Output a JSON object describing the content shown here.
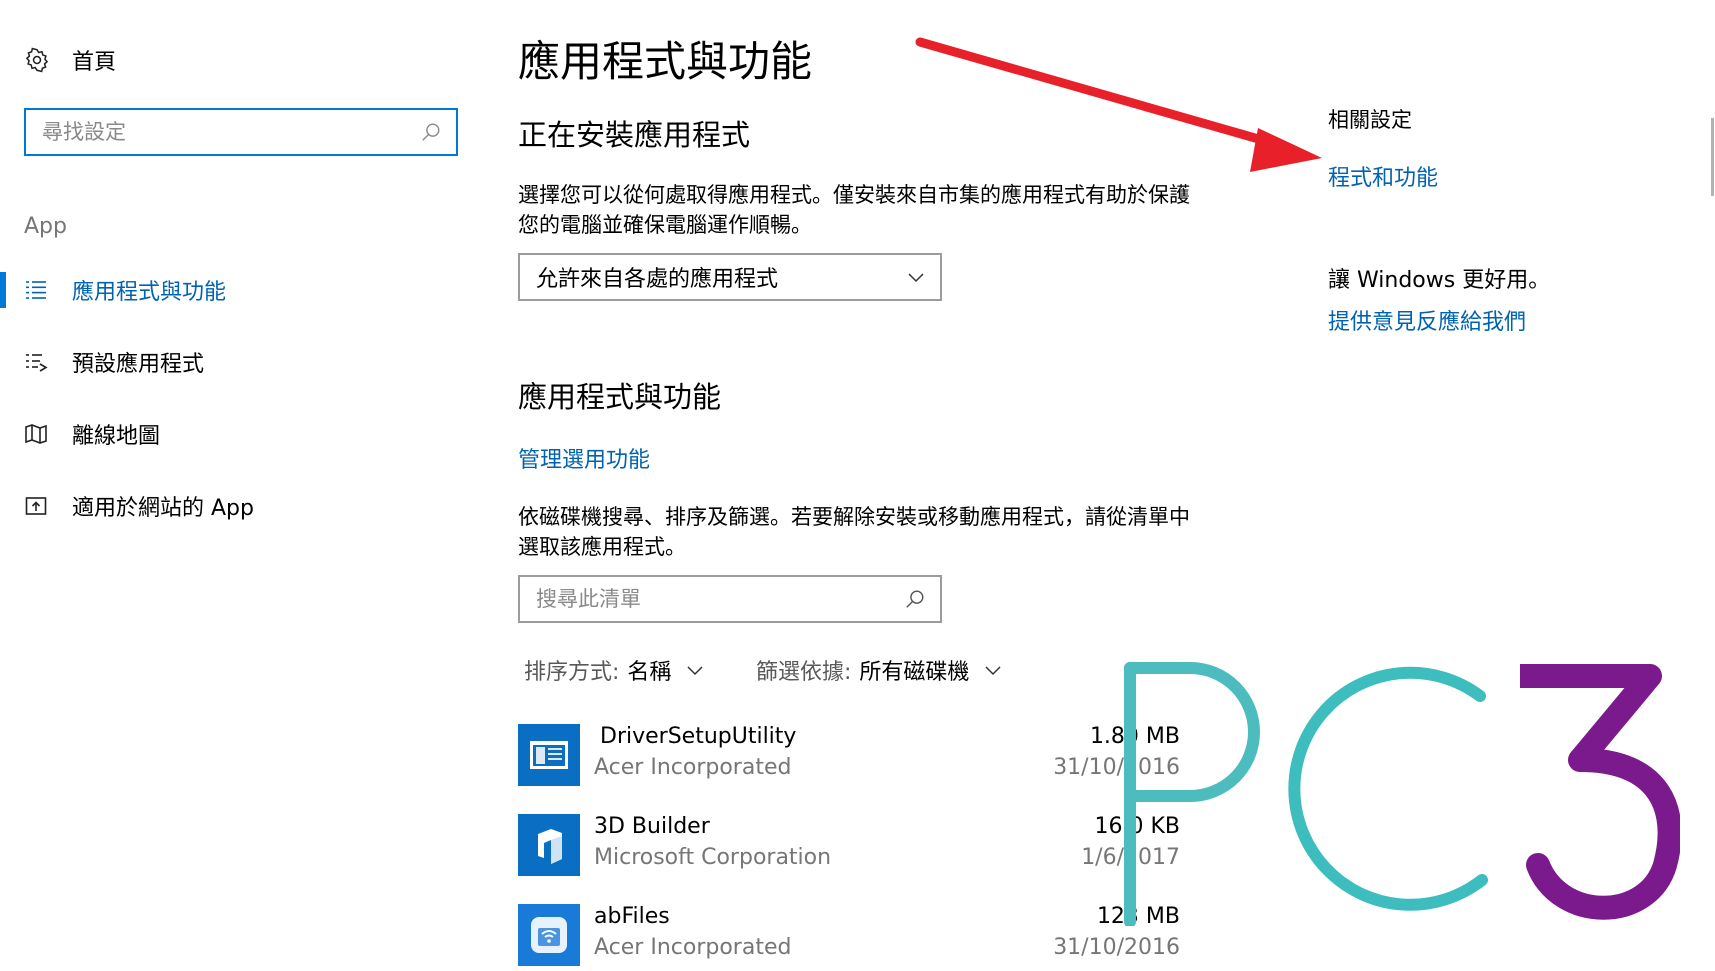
{
  "sidebar": {
    "home_label": "首頁",
    "search_placeholder": "尋找設定",
    "section_label": "App",
    "items": [
      {
        "label": "應用程式與功能",
        "icon": "apps-list-icon",
        "active": true
      },
      {
        "label": "預設應用程式",
        "icon": "default-apps-icon",
        "active": false
      },
      {
        "label": "離線地圖",
        "icon": "map-icon",
        "active": false
      },
      {
        "label": "適用於網站的 App",
        "icon": "web-app-icon",
        "active": false
      }
    ]
  },
  "main": {
    "title": "應用程式與功能",
    "installing": {
      "heading": "正在安裝應用程式",
      "description": "選擇您可以從何處取得應用程式。僅安裝來自市集的應用程式有助於保護您的電腦並確保電腦運作順暢。",
      "dropdown_value": "允許來自各處的應用程式"
    },
    "apps": {
      "heading": "應用程式與功能",
      "manage_link": "管理選用功能",
      "description": "依磁碟機搜尋、排序及篩選。若要解除安裝或移動應用程式，請從清單中選取該應用程式。",
      "search_placeholder": "搜尋此清單",
      "sort_label": "排序方式:",
      "sort_value": "名稱",
      "filter_label": "篩選依據:",
      "filter_value": "所有磁碟機",
      "list": [
        {
          "name": "DriverSetupUtility",
          "publisher": "Acer Incorporated",
          "size": "1.80 MB",
          "date": "31/10/2016",
          "icon": "driver-setup-icon"
        },
        {
          "name": "3D Builder",
          "publisher": "Microsoft Corporation",
          "size": "16.0 KB",
          "date": "1/6/2017",
          "icon": "3d-builder-icon"
        },
        {
          "name": "abFiles",
          "publisher": "Acer Incorporated",
          "size": "123 MB",
          "date": "31/10/2016",
          "icon": "abfiles-icon"
        }
      ]
    }
  },
  "related": {
    "title": "相關設定",
    "programs_link": "程式和功能",
    "feedback_title": "讓 Windows 更好用。",
    "feedback_link": "提供意見反應給我們"
  },
  "overlay": {
    "logo_text": "PC3",
    "arrow_color": "#e8202a",
    "logo_colors": {
      "p": "#4dbcbf",
      "c": "#3dbdbd",
      "three": "#7b1a8c"
    }
  },
  "colors": {
    "accent": "#0078d7",
    "link": "#0063b1"
  }
}
